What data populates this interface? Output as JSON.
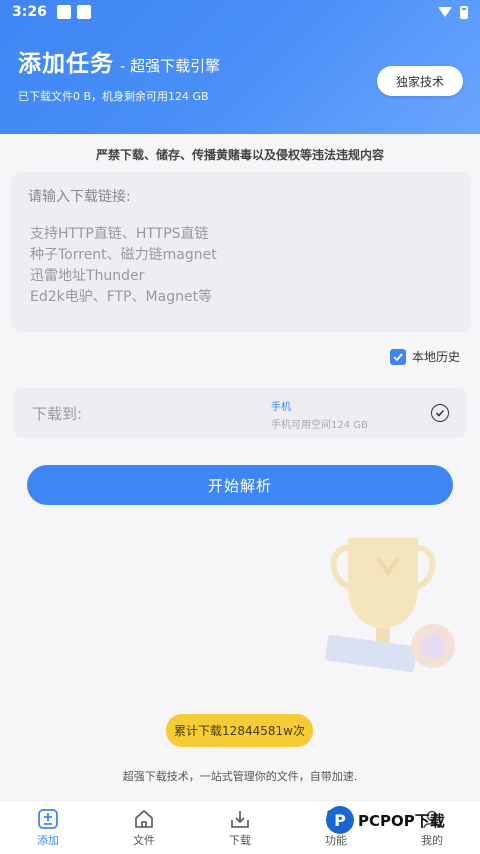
{
  "status_bar": {
    "time": "3:26"
  },
  "header": {
    "title": "添加任务",
    "subtitle": "- 超强下载引擎",
    "info": "已下载文件0 B，机身剩余可用124 GB",
    "exclusive_label": "独家技术"
  },
  "warning": "严禁下载、储存、传播黄赌毒以及侵权等违法违规内容",
  "link_input": {
    "placeholder": "请输入下载链接:",
    "hints": [
      "支持HTTP直链、HTTPS直链",
      "种子Torrent、磁力链magnet",
      "迅雷地址Thunder",
      "Ed2k电驴、FTP、Magnet等"
    ]
  },
  "history_label": "本地历史",
  "download_to": {
    "label": "下载到:",
    "device": "手机",
    "space": "手机可用空间124 GB"
  },
  "start_button": "开始解析",
  "download_count": "累计下载12844581w次",
  "tagline": "超强下载技术，一站式管理你的文件，自带加速.",
  "tabs": [
    {
      "label": "添加",
      "icon": "add-task-icon"
    },
    {
      "label": "文件",
      "icon": "home-icon"
    },
    {
      "label": "下载",
      "icon": "download-icon"
    },
    {
      "label": "功能",
      "icon": "function-icon"
    },
    {
      "label": "我的",
      "icon": "profile-icon"
    }
  ],
  "watermark": {
    "logo": "P",
    "text": "PCPOP下载"
  },
  "colors": {
    "primary": "#3f86f5",
    "badge": "#f5cc35"
  }
}
